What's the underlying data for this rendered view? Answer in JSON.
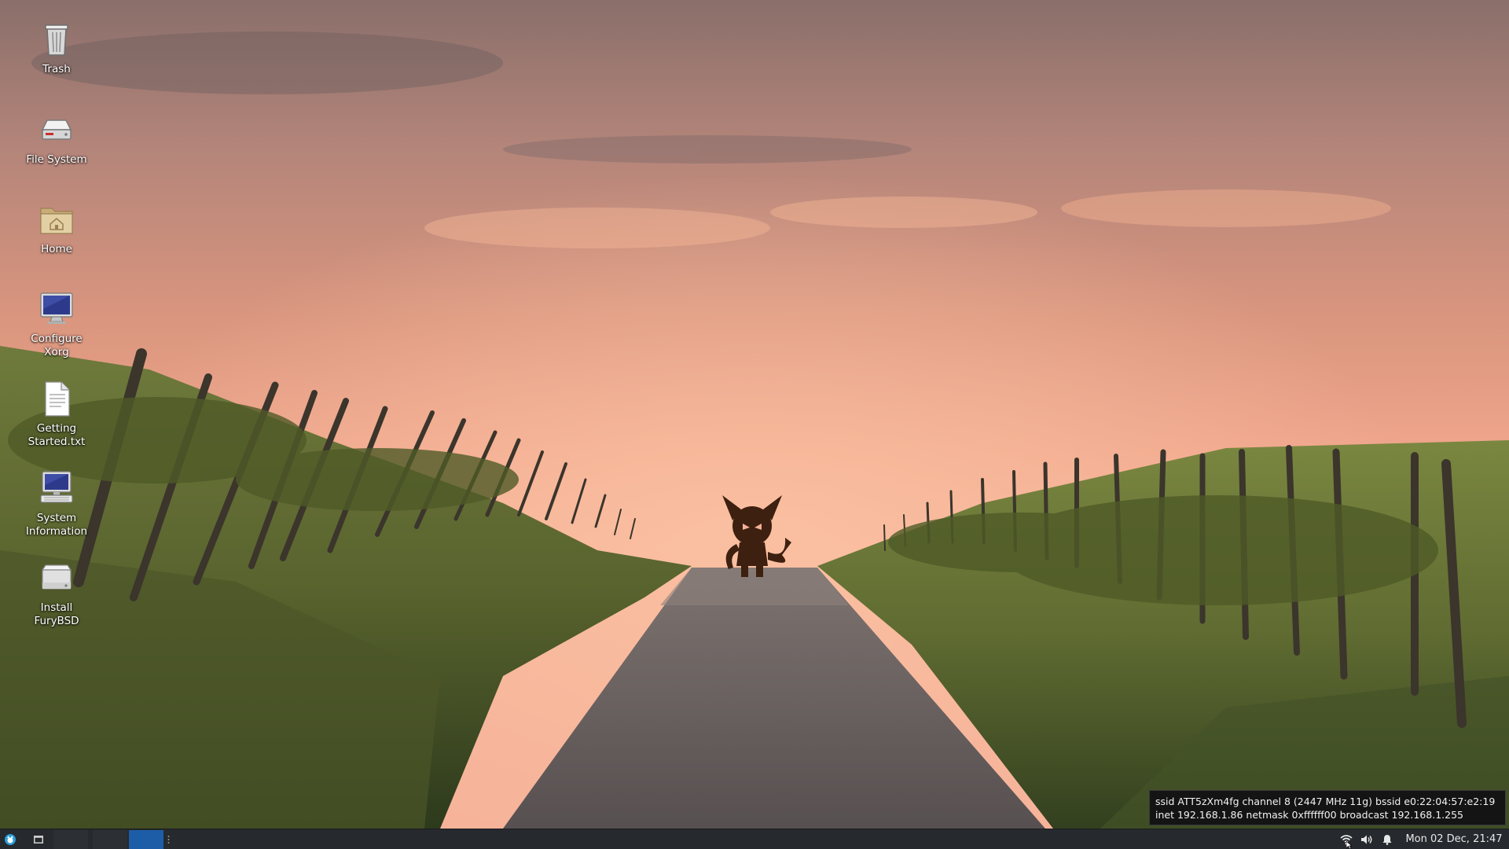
{
  "desktop": {
    "icons": [
      {
        "id": "trash",
        "label": "Trash",
        "icon": "trash-icon"
      },
      {
        "id": "filesystem",
        "label": "File System",
        "icon": "hard-drive-icon"
      },
      {
        "id": "home",
        "label": "Home",
        "icon": "home-folder-icon"
      },
      {
        "id": "configure-xorg",
        "label": "Configure\nXorg",
        "icon": "monitor-icon"
      },
      {
        "id": "getting-started",
        "label": "Getting\nStarted.txt",
        "icon": "text-file-icon"
      },
      {
        "id": "system-information",
        "label": "System\nInformation",
        "icon": "computer-icon"
      },
      {
        "id": "install-furybsd",
        "label": "Install\nFuryBSD",
        "icon": "disk-drive-icon"
      }
    ]
  },
  "tooltip": {
    "line1": "ssid ATT5zXm4fg channel 8 (2447 MHz 11g) bssid e0:22:04:57:e2:19",
    "line2": "inet 192.168.1.86 netmask 0xffffff00 broadcast 192.168.1.255"
  },
  "taskbar": {
    "menu_icon": "furybsd-logo-icon",
    "show_desktop_icon": "show-desktop-icon",
    "workspaces": [
      "1",
      "2",
      "3"
    ],
    "active_workspace": 3,
    "tray": {
      "wifi_icon": "wifi-icon",
      "volume_icon": "volume-icon",
      "notification_icon": "bell-icon"
    },
    "clock": "Mon 02 Dec, 21:47"
  },
  "colors": {
    "taskbar_bg": "#26292d",
    "active_workspace": "#1d5da8",
    "sky_top": "#9a7b72",
    "sky_horizon": "#f0a58a",
    "mascot": "#3d2010"
  }
}
